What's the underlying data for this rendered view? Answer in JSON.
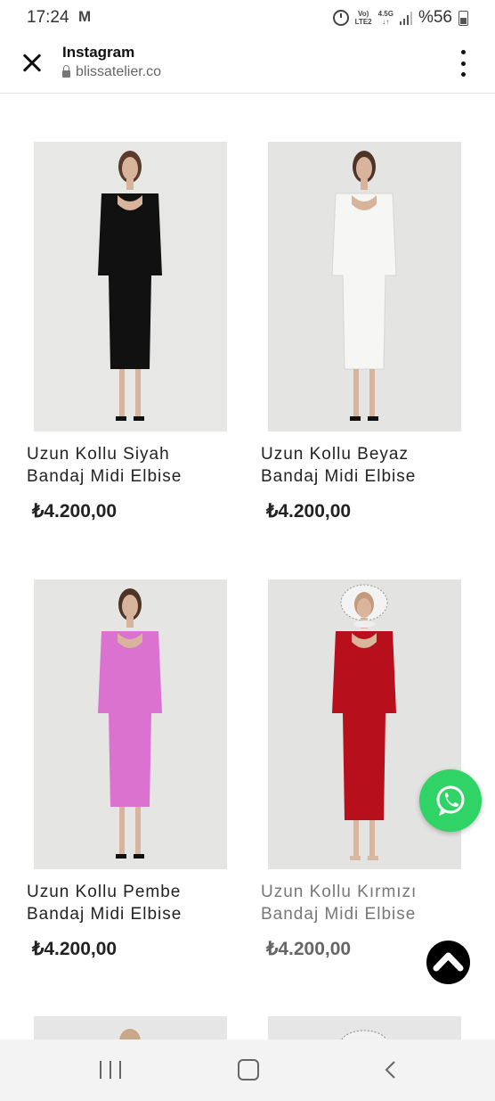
{
  "status_bar": {
    "time": "17:24",
    "mail_icon": "gmail-icon",
    "volte_line1": "Vo)",
    "volte_line2": "LTE2",
    "net_line1": "4.5G",
    "net_line2": "↓↑",
    "battery_text": "%56"
  },
  "header": {
    "title": "Instagram",
    "url": "blissatelier.co"
  },
  "products": [
    {
      "name_line1": "Uzun Kollu Siyah",
      "name_line2": "Bandaj Midi Elbise",
      "price": "₺4.200,00",
      "dress_color": "#111111"
    },
    {
      "name_line1": "Uzun Kollu Beyaz",
      "name_line2": "Bandaj Midi Elbise",
      "price": "₺4.200,00",
      "dress_color": "#f4f4f2"
    },
    {
      "name_line1": "Uzun Kollu Pembe",
      "name_line2": "Bandaj Midi Elbise",
      "price": "₺4.200,00",
      "dress_color": "#dc72cf"
    },
    {
      "name_line1": "Uzun Kollu Kırmızı",
      "name_line2": "Bandaj Midi Elbise",
      "price": "₺4.200,00",
      "dress_color": "#b80f1c"
    }
  ],
  "colors": {
    "whatsapp": "#2fd366",
    "background": "#ffffff"
  },
  "icons": {
    "whatsapp": "whatsapp-icon",
    "scroll_top": "chevron-up-icon",
    "close": "close-icon",
    "menu": "more-vertical-icon"
  }
}
